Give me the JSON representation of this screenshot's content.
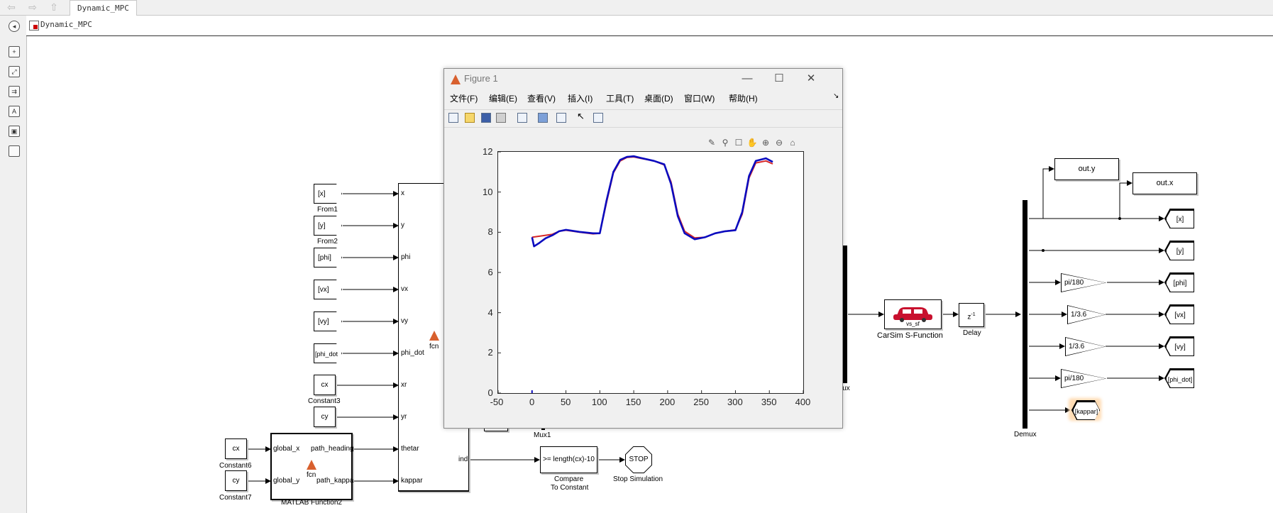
{
  "toolbar": {
    "tab_title": "Dynamic_MPC",
    "breadcrumb": "Dynamic_MPC"
  },
  "blocks": {
    "from_tags": [
      "[x]",
      "[y]",
      "[phi]",
      "[vx]",
      "[vy]",
      "[phi_dot"
    ],
    "from_labels": [
      "From1",
      "From2"
    ],
    "constants": {
      "cx": "cx",
      "cy": "cy",
      "const3": "Constant3",
      "const6": "Constant6",
      "const7": "Constant7"
    },
    "fcn_ports_in": [
      "x",
      "y",
      "phi",
      "vx",
      "vy",
      "phi_dot",
      "xr",
      "yr",
      "thetar",
      "kappar"
    ],
    "fcn_out": "ind",
    "fcn_label": "fcn",
    "mf2": {
      "in1": "global_x",
      "in2": "global_y",
      "out1": "path_heading",
      "out2": "path_kappa",
      "fcn": "fcn",
      "label": "MATLAB Function2"
    },
    "compare": {
      "text": ">= length(cx)-10",
      "label1": "Compare",
      "label2": "To Constant"
    },
    "stop": {
      "text": "STOP",
      "label": "Stop Simulation"
    },
    "mux_label": "Mux1",
    "mux_partial": "lux",
    "carsim": {
      "label": "CarSim S-Function",
      "sub": "vs_sf"
    },
    "delay": {
      "text": "z",
      "sup": "-1",
      "label": "Delay"
    },
    "demux_label": "Demux",
    "outs": [
      "out.y",
      "out.x"
    ],
    "goto_tags": [
      "[x]",
      "[y]",
      "[phi]",
      "[vx]",
      "[vy]",
      "[phi_dot]",
      "[kappar]"
    ],
    "gains": [
      "pi/180",
      "1/3.6",
      "1/3.6",
      "pi/180"
    ]
  },
  "figure": {
    "title": "Figure 1",
    "menus": [
      "文件(F)",
      "编辑(E)",
      "查看(V)",
      "插入(I)",
      "工具(T)",
      "桌面(D)",
      "窗口(W)",
      "帮助(H)"
    ],
    "window_controls": [
      "—",
      "☐",
      "✕"
    ]
  },
  "chart_data": {
    "type": "line",
    "title": "",
    "xlabel": "",
    "ylabel": "",
    "xlim": [
      -50,
      400
    ],
    "ylim": [
      0,
      12
    ],
    "xticks": [
      "-50",
      "0",
      "50",
      "100",
      "150",
      "200",
      "250",
      "300",
      "350",
      "400"
    ],
    "yticks": [
      "0",
      "2",
      "4",
      "6",
      "8",
      "10",
      "12"
    ],
    "grid": false,
    "series": [
      {
        "color": "#d62728",
        "points": [
          [
            0,
            7.75
          ],
          [
            10,
            7.8
          ],
          [
            20,
            7.85
          ],
          [
            30,
            7.9
          ],
          [
            40,
            8.05
          ],
          [
            50,
            8.1
          ],
          [
            70,
            8.0
          ],
          [
            90,
            7.92
          ],
          [
            100,
            7.95
          ],
          [
            110,
            9.5
          ],
          [
            120,
            10.95
          ],
          [
            130,
            11.55
          ],
          [
            140,
            11.72
          ],
          [
            150,
            11.75
          ],
          [
            160,
            11.68
          ],
          [
            180,
            11.55
          ],
          [
            195,
            11.35
          ],
          [
            205,
            10.5
          ],
          [
            215,
            8.9
          ],
          [
            225,
            8.05
          ],
          [
            240,
            7.72
          ],
          [
            255,
            7.75
          ],
          [
            270,
            7.95
          ],
          [
            285,
            8.05
          ],
          [
            300,
            8.12
          ],
          [
            310,
            8.9
          ],
          [
            320,
            10.7
          ],
          [
            330,
            11.45
          ],
          [
            345,
            11.55
          ],
          [
            355,
            11.4
          ]
        ]
      },
      {
        "color": "#0b0bbf",
        "points": [
          [
            0,
            7.75
          ],
          [
            3,
            7.3
          ],
          [
            10,
            7.45
          ],
          [
            20,
            7.7
          ],
          [
            30,
            7.85
          ],
          [
            40,
            8.05
          ],
          [
            50,
            8.12
          ],
          [
            70,
            8.02
          ],
          [
            90,
            7.95
          ],
          [
            100,
            7.95
          ],
          [
            110,
            9.6
          ],
          [
            120,
            11.0
          ],
          [
            130,
            11.6
          ],
          [
            140,
            11.75
          ],
          [
            150,
            11.78
          ],
          [
            160,
            11.7
          ],
          [
            180,
            11.55
          ],
          [
            195,
            11.38
          ],
          [
            205,
            10.4
          ],
          [
            215,
            8.8
          ],
          [
            225,
            7.95
          ],
          [
            240,
            7.65
          ],
          [
            255,
            7.75
          ],
          [
            270,
            7.95
          ],
          [
            285,
            8.05
          ],
          [
            300,
            8.1
          ],
          [
            310,
            9.0
          ],
          [
            320,
            10.8
          ],
          [
            330,
            11.55
          ],
          [
            345,
            11.68
          ],
          [
            355,
            11.5
          ]
        ]
      }
    ]
  }
}
